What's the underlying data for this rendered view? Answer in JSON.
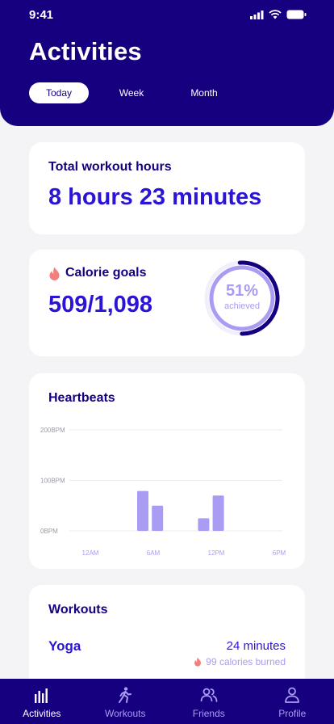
{
  "status_bar": {
    "time": "9:41"
  },
  "header": {
    "title": "Activities",
    "tabs": [
      {
        "label": "Today",
        "active": true
      },
      {
        "label": "Week",
        "active": false
      },
      {
        "label": "Month",
        "active": false
      }
    ]
  },
  "workout_hours": {
    "title": "Total workout hours",
    "value": "8 hours 23 minutes"
  },
  "calorie_goals": {
    "title": "Calorie goals",
    "value": "509/1,098",
    "percent": "51%",
    "percent_caption": "achieved",
    "progress_fraction": 0.51,
    "icon": "flame-icon"
  },
  "heartbeats": {
    "title": "Heartbeats",
    "chart_data": {
      "type": "bar",
      "y_tick_labels": [
        "200BPM",
        "100BPM",
        "0BPM"
      ],
      "y_ticks": [
        200,
        100,
        0
      ],
      "x_tick_labels": [
        "12AM",
        "6AM",
        "12PM",
        "6PM"
      ],
      "ylim": [
        0,
        200
      ],
      "bars": [
        {
          "hour": 5.0,
          "value": 79
        },
        {
          "hour": 6.4,
          "value": 50
        },
        {
          "hour": 10.8,
          "value": 25
        },
        {
          "hour": 12.2,
          "value": 70
        }
      ],
      "grid": true,
      "bar_color": "#a99cf3"
    }
  },
  "workouts": {
    "title": "Workouts",
    "items": [
      {
        "name": "Yoga",
        "duration": "24 minutes",
        "calories": "99 calories burned"
      }
    ]
  },
  "bottom_nav": {
    "items": [
      {
        "label": "Activities",
        "icon": "activity-bars-icon",
        "active": true
      },
      {
        "label": "Workouts",
        "icon": "running-person-icon",
        "active": false
      },
      {
        "label": "Friends",
        "icon": "friends-icon",
        "active": false
      },
      {
        "label": "Profile",
        "icon": "profile-icon",
        "active": false
      }
    ]
  },
  "colors": {
    "brand": "#16007f",
    "accent": "#2a15d6",
    "light_accent": "#a99cf3",
    "flame": "#f37e7e",
    "background": "#f4f4f6"
  }
}
